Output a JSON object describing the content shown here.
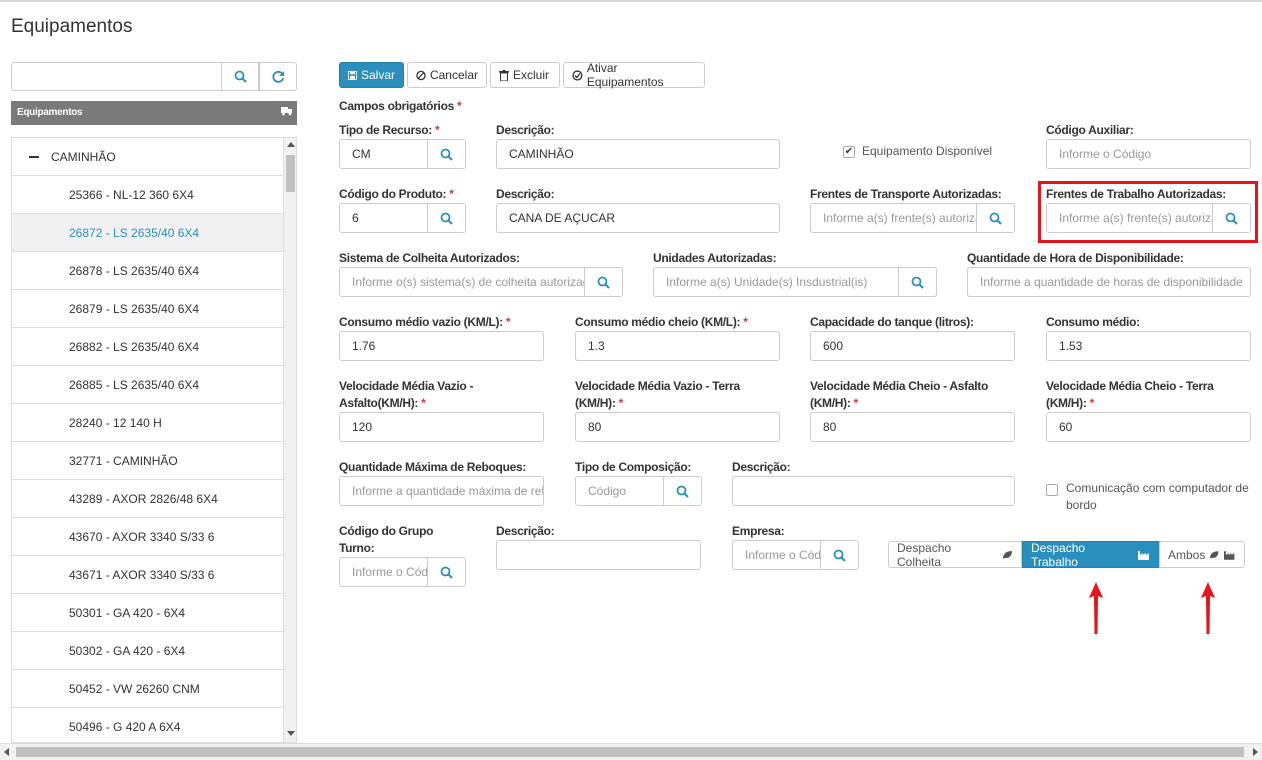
{
  "page": {
    "title": "Equipamentos"
  },
  "sidebar": {
    "header": "Equipamentos",
    "tree_root": "CAMINHÃO",
    "items": [
      "25366 - NL-12 360 6X4",
      "26872 - LS 2635/40 6X4",
      "26878 - LS 2635/40 6X4",
      "26879 - LS 2635/40 6X4",
      "26882 - LS 2635/40 6X4",
      "26885 - LS 2635/40 6X4",
      "28240 - 12 140 H",
      "32771 - CAMINHÃO",
      "43289 - AXOR 2826/48 6X4",
      "43670 - AXOR 3340 S/33 6",
      "43671 - AXOR 3340 S/33 6",
      "50301 - GA 420 - 6X4",
      "50302 - GA 420 - 6X4",
      "50452 - VW 26260 CNM",
      "50496 - G 420 A 6X4"
    ],
    "selected_index": 1
  },
  "toolbar": {
    "save": "Salvar",
    "cancel": "Cancelar",
    "delete": "Excluir",
    "activate": "Ativar Equipamentos"
  },
  "form": {
    "required_note": "Campos obrigatórios",
    "tipo_recurso": {
      "label": "Tipo de Recurso:",
      "value": "CM"
    },
    "descricao1": {
      "label": "Descrição:",
      "value": "CAMINHÃO"
    },
    "equip_disponivel": {
      "label": "Equipamento Disponível",
      "checked": true
    },
    "codigo_auxiliar": {
      "label": "Código Auxiliar:",
      "placeholder": "Informe o Código"
    },
    "codigo_produto": {
      "label": "Código do Produto:",
      "value": "6"
    },
    "descricao2": {
      "label": "Descrição:",
      "value": "CANA DE AÇUCAR"
    },
    "frentes_transporte": {
      "label": "Frentes de Transporte Autorizadas:",
      "placeholder": "Informe a(s) frente(s) autorizada(s)"
    },
    "frentes_trabalho": {
      "label": "Frentes de Trabalho Autorizadas:",
      "placeholder": "Informe a(s) frente(s) autorizada(s)"
    },
    "sistema_colheita": {
      "label": "Sistema de Colheita Autorizados:",
      "placeholder": "Informe o(s) sistema(s) de colheita autorizado(s)"
    },
    "unidades": {
      "label": "Unidades Autorizadas:",
      "placeholder": "Informe a(s) Unidade(s) Insdustrial(is)"
    },
    "qtd_hora": {
      "label": "Quantidade de Hora de Disponibilidade:",
      "placeholder": "Informe a quantidade de horas de disponibilidade"
    },
    "consumo_vazio": {
      "label": "Consumo médio vazio (KM/L):",
      "value": "1.76"
    },
    "consumo_cheio": {
      "label": "Consumo médio cheio (KM/L):",
      "value": "1.3"
    },
    "capacidade_tanque": {
      "label": "Capacidade do tanque (litros):",
      "value": "600"
    },
    "consumo_medio": {
      "label": "Consumo médio:",
      "value": "1.53"
    },
    "vel_vazio_asfalto": {
      "label_l1": "Velocidade Média Vazio -",
      "label_l2": "Asfalto(KM/H):",
      "value": "120"
    },
    "vel_vazio_terra": {
      "label_l1": "Velocidade Média Vazio - Terra",
      "label_l2": "(KM/H):",
      "value": "80"
    },
    "vel_cheio_asfalto": {
      "label_l1": "Velocidade Média Cheio - Asfalto",
      "label_l2": "(KM/H):",
      "value": "80"
    },
    "vel_cheio_terra": {
      "label_l1": "Velocidade Média Cheio - Terra",
      "label_l2": "(KM/H):",
      "value": "60"
    },
    "qtd_reboques": {
      "label": "Quantidade Máxima de Reboques:",
      "placeholder": "Informe a quantidade máxima de reboques"
    },
    "tipo_composicao": {
      "label": "Tipo de Composição:",
      "placeholder": "Código"
    },
    "descricao3": {
      "label": "Descrição:",
      "value": ""
    },
    "comunicacao": {
      "label_l1": "Comunicação com computador de",
      "label_l2": "bordo",
      "checked": false
    },
    "grupo_turno": {
      "label_l1": "Código do Grupo",
      "label_l2": "Turno:",
      "placeholder": "Informe o Código"
    },
    "descricao4": {
      "label": "Descrição:",
      "value": ""
    },
    "empresa": {
      "label": "Empresa:",
      "placeholder": "Informe o Código"
    },
    "despacho": {
      "options": [
        "Despacho Colheita",
        "Despacho Trabalho",
        "Ambos"
      ],
      "selected": "Despacho Trabalho"
    }
  },
  "colors": {
    "accent": "#2a8fbd",
    "highlight": "#e8141b",
    "sidebar_header_bg": "#7a7a7a"
  }
}
